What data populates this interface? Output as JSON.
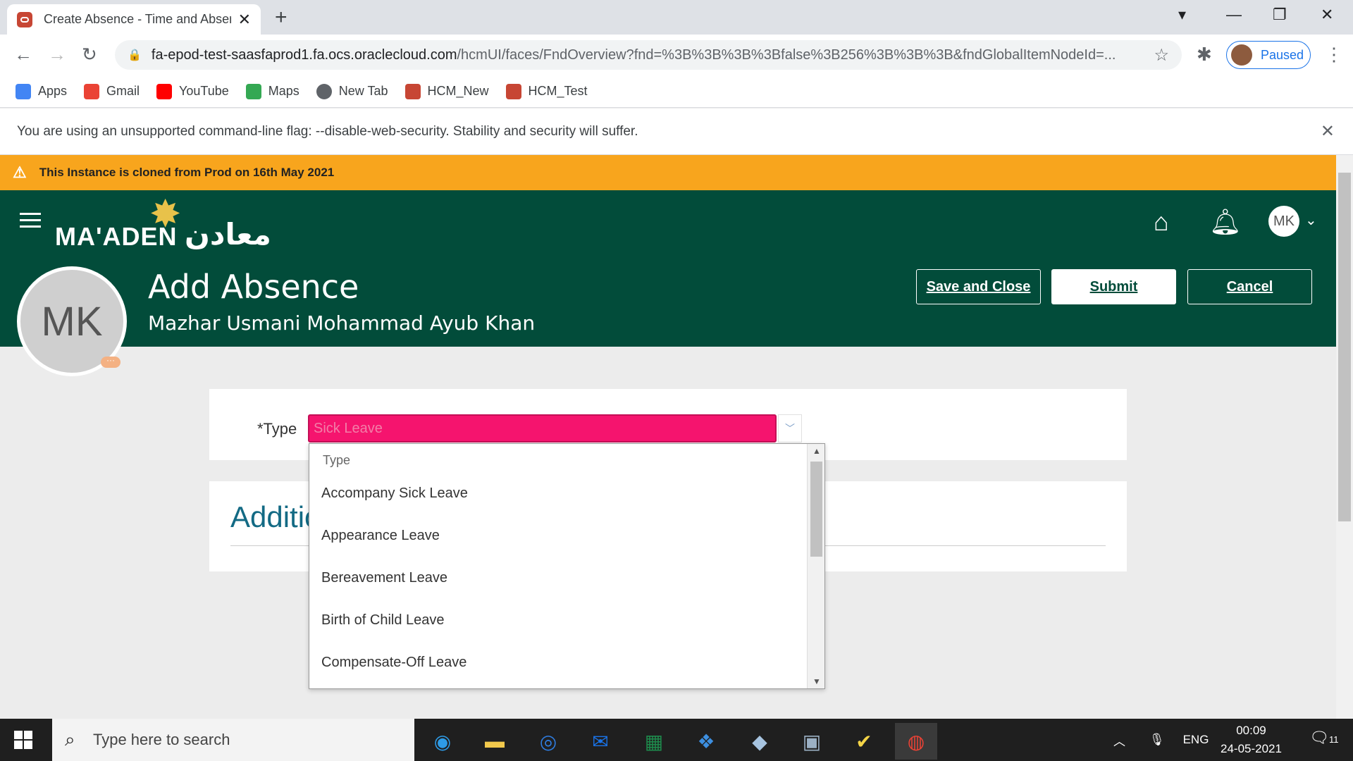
{
  "browser": {
    "tab_title": "Create Absence - Time and Absences",
    "url_host": "fa-epod-test-saasfaprod1.fa.ocs.oraclecloud.com",
    "url_path": "/hcmUI/faces/FndOverview?fnd=%3B%3B%3B%3Bfalse%3B256%3B%3B%3B&fndGlobalItemNodeId=...",
    "profile_label": "Paused",
    "bookmarks": [
      "Apps",
      "Gmail",
      "YouTube",
      "Maps",
      "New Tab",
      "HCM_New",
      "HCM_Test"
    ],
    "warning": "You are using an unsupported command-line flag: --disable-web-security. Stability and security will suffer."
  },
  "banner": "This Instance is cloned from Prod on 16th May 2021",
  "header": {
    "logo_text": "MA'ADEN",
    "logo_arabic": "معادن",
    "user_initials": "MK",
    "page_title": "Add Absence",
    "person_name": "Mazhar Usmani Mohammad Ayub Khan",
    "buttons": {
      "save": "Save and Close",
      "submit": "Submit",
      "cancel": "Cancel"
    }
  },
  "form": {
    "type_label": "*Type",
    "type_value": "Sick Leave",
    "section_title": "Additional Information"
  },
  "dropdown": {
    "header": "Type",
    "items": [
      "Accompany Sick Leave",
      "Appearance Leave",
      "Bereavement Leave",
      "Birth of Child Leave",
      "Compensate-Off Leave"
    ]
  },
  "taskbar": {
    "search_placeholder": "Type here to search",
    "language": "ENG",
    "time": "00:09",
    "date": "24-05-2021",
    "notifications": "11"
  },
  "colors": {
    "header": "#024c3a",
    "banner": "#f8a51d",
    "error_input": "#f5146e"
  }
}
